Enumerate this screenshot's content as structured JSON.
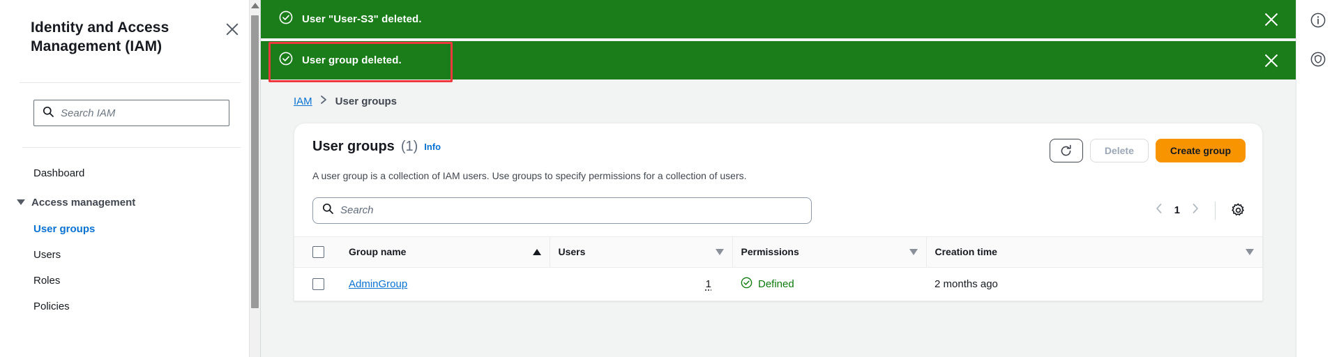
{
  "sidebar": {
    "title": "Identity and Access Management (IAM)",
    "close_label": "×",
    "search": {
      "placeholder": "Search IAM",
      "value": ""
    },
    "dashboard_label": "Dashboard",
    "group_label": "Access management",
    "items": [
      {
        "label": "User groups",
        "active": true
      },
      {
        "label": "Users",
        "active": false
      },
      {
        "label": "Roles",
        "active": false
      },
      {
        "label": "Policies",
        "active": false
      }
    ]
  },
  "flash_messages": [
    {
      "text": "User \"User-S3\" deleted.",
      "type": "success",
      "color": "#1a7d1a"
    },
    {
      "text": "User group deleted.",
      "type": "success",
      "color": "#1a7d1a"
    }
  ],
  "breadcrumb": {
    "root": "IAM",
    "separator": "›",
    "current": "User groups"
  },
  "card": {
    "title": "User groups",
    "count": "(1)",
    "info_label": "Info",
    "description": "A user group is a collection of IAM users. Use groups to specify permissions for a collection of users.",
    "refresh_label": "",
    "delete_label": "Delete",
    "create_label": "Create group"
  },
  "table_search": {
    "placeholder": "Search",
    "value": ""
  },
  "pagination": {
    "page": "1",
    "prev": "‹",
    "next": "›"
  },
  "table": {
    "columns": [
      {
        "label": "Group name",
        "sort": "asc"
      },
      {
        "label": "Users",
        "sort": "none"
      },
      {
        "label": "Permissions",
        "sort": "none"
      },
      {
        "label": "Creation time",
        "sort": "none"
      }
    ],
    "rows": [
      {
        "group_name": "AdminGroup",
        "users": "1",
        "permissions": "Defined",
        "creation_time": "2 months ago"
      }
    ]
  },
  "colors": {
    "success_green": "#1a7d1a",
    "link_blue": "#0972d3",
    "accent_orange": "#f79400",
    "highlight_red": "#f0383f",
    "defined_green": "#0d7a0d"
  }
}
